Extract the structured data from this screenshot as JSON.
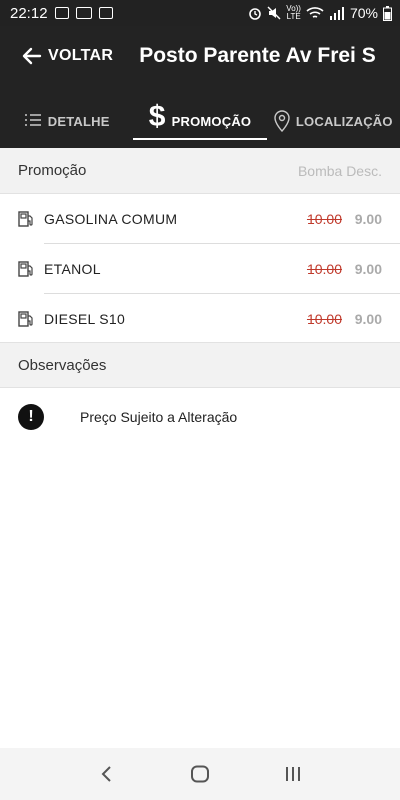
{
  "status_bar": {
    "time": "22:12",
    "battery": "70%",
    "left_icons": [
      "image-icon",
      "laptop-icon",
      "voicemail-icon"
    ],
    "right_icons": [
      "alarm-icon",
      "mute-icon",
      "volte-icon",
      "wifi-icon",
      "signal-icon",
      "battery-icon"
    ],
    "volte_label_top": "Vo))",
    "volte_label_bottom": "LTE"
  },
  "app_bar": {
    "back_label": "VOLTAR",
    "title": "Posto Parente Av Frei S"
  },
  "tabs": [
    {
      "label": "DETALHE",
      "icon": "list-icon",
      "active": false
    },
    {
      "label": "PROMOÇÃO",
      "icon": "dollar-icon",
      "active": true
    },
    {
      "label": "LOCALIZAÇÃO",
      "icon": "location-pin-icon",
      "active": false
    }
  ],
  "tab_icons": {
    "dollar": "$"
  },
  "promo_section": {
    "title": "Promoção",
    "right_label": "Bomba Desc."
  },
  "fuels": [
    {
      "name": "GASOLINA COMUM",
      "old_price": "10.00",
      "new_price": "9.00"
    },
    {
      "name": "ETANOL",
      "old_price": "10.00",
      "new_price": "9.00"
    },
    {
      "name": "DIESEL S10",
      "old_price": "10.00",
      "new_price": "9.00"
    }
  ],
  "obs_section": {
    "title": "Observações"
  },
  "observations": [
    {
      "icon": "!",
      "text": "Preço Sujeito a Alteração"
    }
  ],
  "colors": {
    "app_bar_bg": "#232323",
    "old_price": "#c0392b",
    "new_price": "#aaaaaa"
  }
}
